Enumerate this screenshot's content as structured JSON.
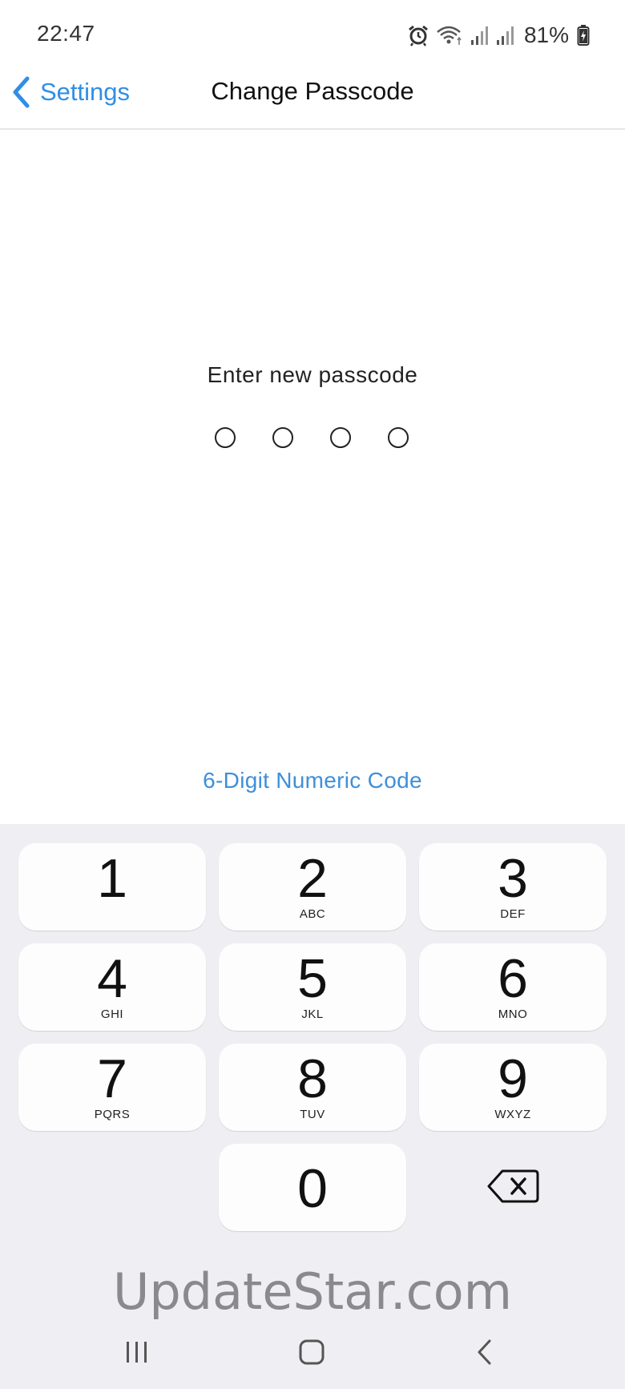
{
  "status_bar": {
    "time": "22:47",
    "battery": "81%",
    "icons": [
      "alarm-icon",
      "wifi-icon",
      "signal-icon",
      "signal-icon",
      "battery-charging-icon"
    ]
  },
  "nav": {
    "back_label": "Settings",
    "title": "Change Passcode"
  },
  "passcode": {
    "prompt": "Enter new passcode",
    "digits_total": 4,
    "digits_entered": 0
  },
  "option_link": "6-Digit Numeric Code",
  "keypad": {
    "keys": [
      {
        "num": "1",
        "letters": ""
      },
      {
        "num": "2",
        "letters": "ABC"
      },
      {
        "num": "3",
        "letters": "DEF"
      },
      {
        "num": "4",
        "letters": "GHI"
      },
      {
        "num": "5",
        "letters": "JKL"
      },
      {
        "num": "6",
        "letters": "MNO"
      },
      {
        "num": "7",
        "letters": "PQRS"
      },
      {
        "num": "8",
        "letters": "TUV"
      },
      {
        "num": "9",
        "letters": "WXYZ"
      },
      {
        "num": "0",
        "letters": ""
      }
    ]
  },
  "watermark": "UpdateStar.com",
  "colors": {
    "accent": "#2f8ee6",
    "keypad_bg": "#efeff3",
    "key_bg": "#fdfdfd"
  }
}
